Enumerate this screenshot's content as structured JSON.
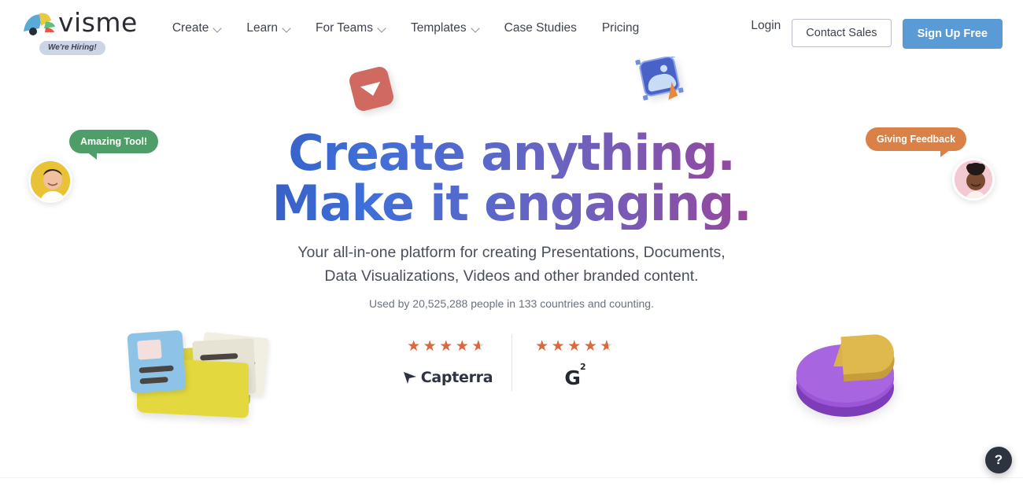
{
  "header": {
    "brand": {
      "wordmark": "visme",
      "logo_icon": "visme-fan-logo-icon",
      "hiring_badge": "We're Hiring!"
    },
    "nav": [
      {
        "label": "Create",
        "has_dropdown": true,
        "icon": "chevron-down-icon"
      },
      {
        "label": "Learn",
        "has_dropdown": true,
        "icon": "chevron-down-icon"
      },
      {
        "label": "For Teams",
        "has_dropdown": true,
        "icon": "chevron-down-icon"
      },
      {
        "label": "Templates",
        "has_dropdown": true,
        "icon": "chevron-down-icon"
      },
      {
        "label": "Case Studies",
        "has_dropdown": false,
        "icon": ""
      },
      {
        "label": "Pricing",
        "has_dropdown": false,
        "icon": ""
      }
    ],
    "login_label": "Login",
    "contact_sales_label": "Contact Sales",
    "signup_label": "Sign Up Free",
    "signup_color": "#5b9bd5"
  },
  "hero": {
    "headline_line1": "Create anything.",
    "headline_line2": "Make it engaging.",
    "headline_gradient_start": "#2b3e96",
    "headline_gradient_end": "#d32f5e",
    "subhead_line1": "Your all-in-one platform for creating Presentations, Documents,",
    "subhead_line2": "Data Visualizations, Videos and other branded content.",
    "used_by": "Used by 20,525,288 people in 133 countries and counting."
  },
  "ratings": [
    {
      "name": "Capterra",
      "logo_icon": "capterra-logo-icon",
      "stars_full": 4,
      "stars_half": 1,
      "rating": 4.5,
      "star_color": "#d9693f"
    },
    {
      "name": "G2",
      "logo_icon": "g2-logo-icon",
      "logo_text": "G",
      "logo_superscript": "2",
      "stars_full": 4,
      "stars_half": 1,
      "rating": 4.5,
      "star_color": "#d9693f"
    }
  ],
  "testimonial_bubbles": [
    {
      "text": "Amazing Tool!",
      "color": "#4f9d69",
      "avatar_name": "avatar-male-left",
      "avatar_bg": "#e8c338",
      "position": "left"
    },
    {
      "text": "Giving Feedback",
      "color": "#d98147",
      "avatar_name": "avatar-female-right",
      "avatar_bg": "#f3c9d4",
      "position": "right"
    }
  ],
  "decorations": [
    {
      "name": "video-play-card-icon",
      "color": "#d0695f"
    },
    {
      "name": "image-editor-card-icon",
      "color": "#4862c8"
    },
    {
      "name": "document-folder-icon",
      "color": "#e3d93f"
    },
    {
      "name": "pie-chart-3d-icon",
      "color": "#a765e0"
    }
  ],
  "help": {
    "label": "?",
    "icon": "help-question-icon"
  }
}
